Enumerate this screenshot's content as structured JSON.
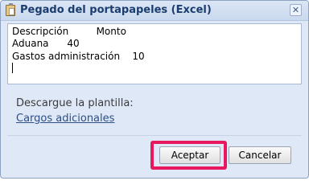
{
  "dialog": {
    "title": "Pegado del portapapeles (Excel)",
    "close_symbol": "✕",
    "icon": "clipboard-icon"
  },
  "textarea": {
    "lines": [
      "Descripción         Monto",
      "Aduana      40",
      "Gastos administración    10"
    ]
  },
  "template": {
    "label": "Descargue la plantilla:",
    "link": "Cargos adicionales"
  },
  "buttons": {
    "accept": "Aceptar",
    "cancel": "Cancelar"
  },
  "colors": {
    "highlight": "#e8185f",
    "title_text": "#1b3d6e",
    "dialog_bg": "#dfe8f6"
  }
}
